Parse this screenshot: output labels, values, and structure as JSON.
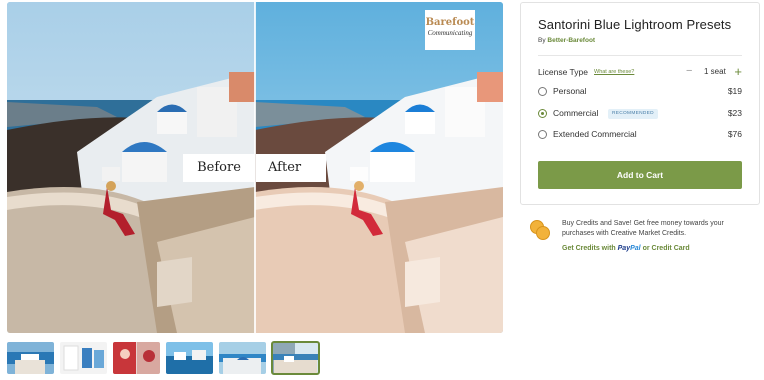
{
  "product": {
    "title": "Santorini Blue Lightroom Presets",
    "by_prefix": "By",
    "author": "Better-Barefoot"
  },
  "preview": {
    "before_label": "Before",
    "after_label": "After",
    "logo_line1": "Barefoot",
    "logo_line2": "Communicating"
  },
  "license": {
    "label": "License Type",
    "help_link": "What are these?",
    "seat_label": "1 seat",
    "minus_symbol": "−",
    "plus_symbol": "+",
    "options": [
      {
        "label": "Personal",
        "price": "$19",
        "selected": false,
        "badge": ""
      },
      {
        "label": "Commercial",
        "price": "$23",
        "selected": true,
        "badge": "RECOMMENDED"
      },
      {
        "label": "Extended Commercial",
        "price": "$76",
        "selected": false,
        "badge": ""
      }
    ]
  },
  "cart_button": "Add to Cart",
  "credits": {
    "text": "Buy Credits and Save! Get free money towards your purchases with Creative Market Credits.",
    "link_prefix": "Get Credits with",
    "paypal_a": "Pay",
    "paypal_b": "Pal",
    "link_suffix": "or Credit Card"
  },
  "thumbnails": [
    "thumbnail-1",
    "thumbnail-2",
    "thumbnail-3",
    "thumbnail-4",
    "thumbnail-5",
    "thumbnail-6"
  ],
  "active_thumbnail": 6,
  "colors": {
    "accent_green": "#7b9a48",
    "link_green": "#6b8a3a",
    "badge_blue": "#4a7fa8"
  }
}
